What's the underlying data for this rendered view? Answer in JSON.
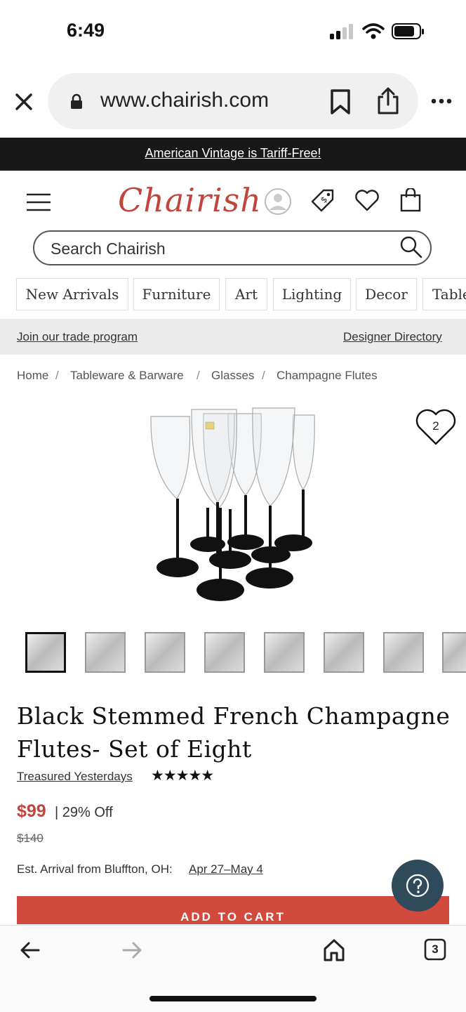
{
  "status_bar": {
    "time": "6:49"
  },
  "browser": {
    "url": "www.chairish.com"
  },
  "promo_banner": {
    "text": "American Vintage is Tariff-Free!"
  },
  "header": {
    "logo": "Chairish"
  },
  "search": {
    "placeholder": "Search Chairish"
  },
  "categories": [
    "New Arrivals",
    "Furniture",
    "Art",
    "Lighting",
    "Decor",
    "Table"
  ],
  "trade": {
    "left_link": "Join our trade program",
    "right_link": "Designer Directory"
  },
  "breadcrumb": [
    "Home",
    "Tableware & Barware",
    "Glasses",
    "Champagne Flutes"
  ],
  "product": {
    "favorite_count": "2",
    "title_line1": "Black Stemmed French Champagne",
    "title_line2": "Flutes- Set of Eight",
    "seller": "Treasured Yesterdays",
    "rating": "★★★★★",
    "price": "$99",
    "discount": "| 29% Off",
    "original_price": "$140",
    "arrival_label": "Est. Arrival from Bluffton, OH:",
    "arrival_dates": "Apr 27–May 4",
    "add_to_cart": "ADD TO CART"
  },
  "tabs_count": "3",
  "colors": {
    "brand": "#c0463d",
    "button": "#d2493e",
    "help": "#2f4a5a",
    "banner": "#181818"
  }
}
